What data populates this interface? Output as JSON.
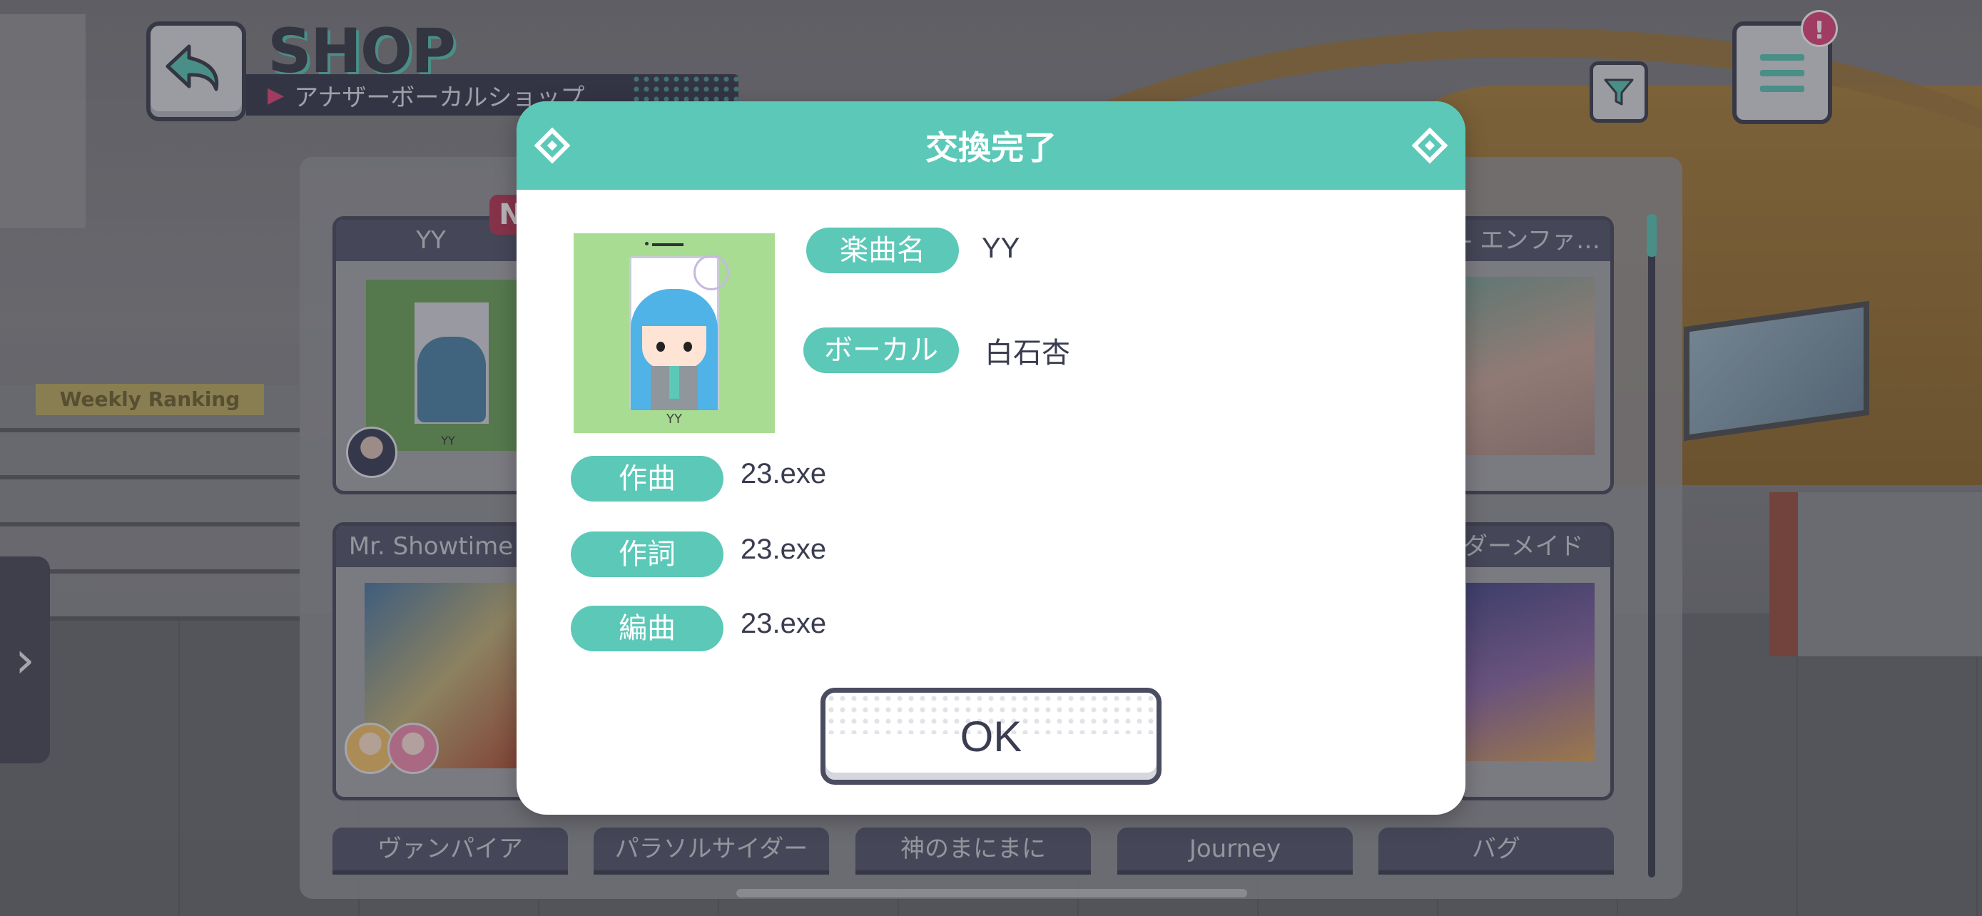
{
  "header": {
    "title": "SHOP",
    "subtitle": "アナザーボーカルショップ"
  },
  "shop": {
    "cards": [
      {
        "title": "YY",
        "badge": "N",
        "jacket_caption": "YY"
      },
      {
        "title": "Mr. Showtime"
      },
      {
        "title": "- エンファ…"
      },
      {
        "title": "ダーメイド"
      }
    ],
    "tabs": [
      "ヴァンパイア",
      "パラソルサイダー",
      "神のまにまに",
      "Journey",
      "バグ"
    ]
  },
  "alert": {
    "badge": "!"
  },
  "dialog": {
    "title": "交換完了",
    "jacket_caption": "YY",
    "fields": [
      {
        "label": "楽曲名",
        "value": "YY"
      },
      {
        "label": "ボーカル",
        "value": "白石杏"
      },
      {
        "label": "作曲",
        "value": "23.exe"
      },
      {
        "label": "作詞",
        "value": "23.exe"
      },
      {
        "label": "編曲",
        "value": "23.exe"
      }
    ],
    "ok_label": "OK"
  },
  "colors": {
    "accent": "#5bc8b8",
    "dark": "#3a3c50",
    "alert": "#e0487d"
  }
}
